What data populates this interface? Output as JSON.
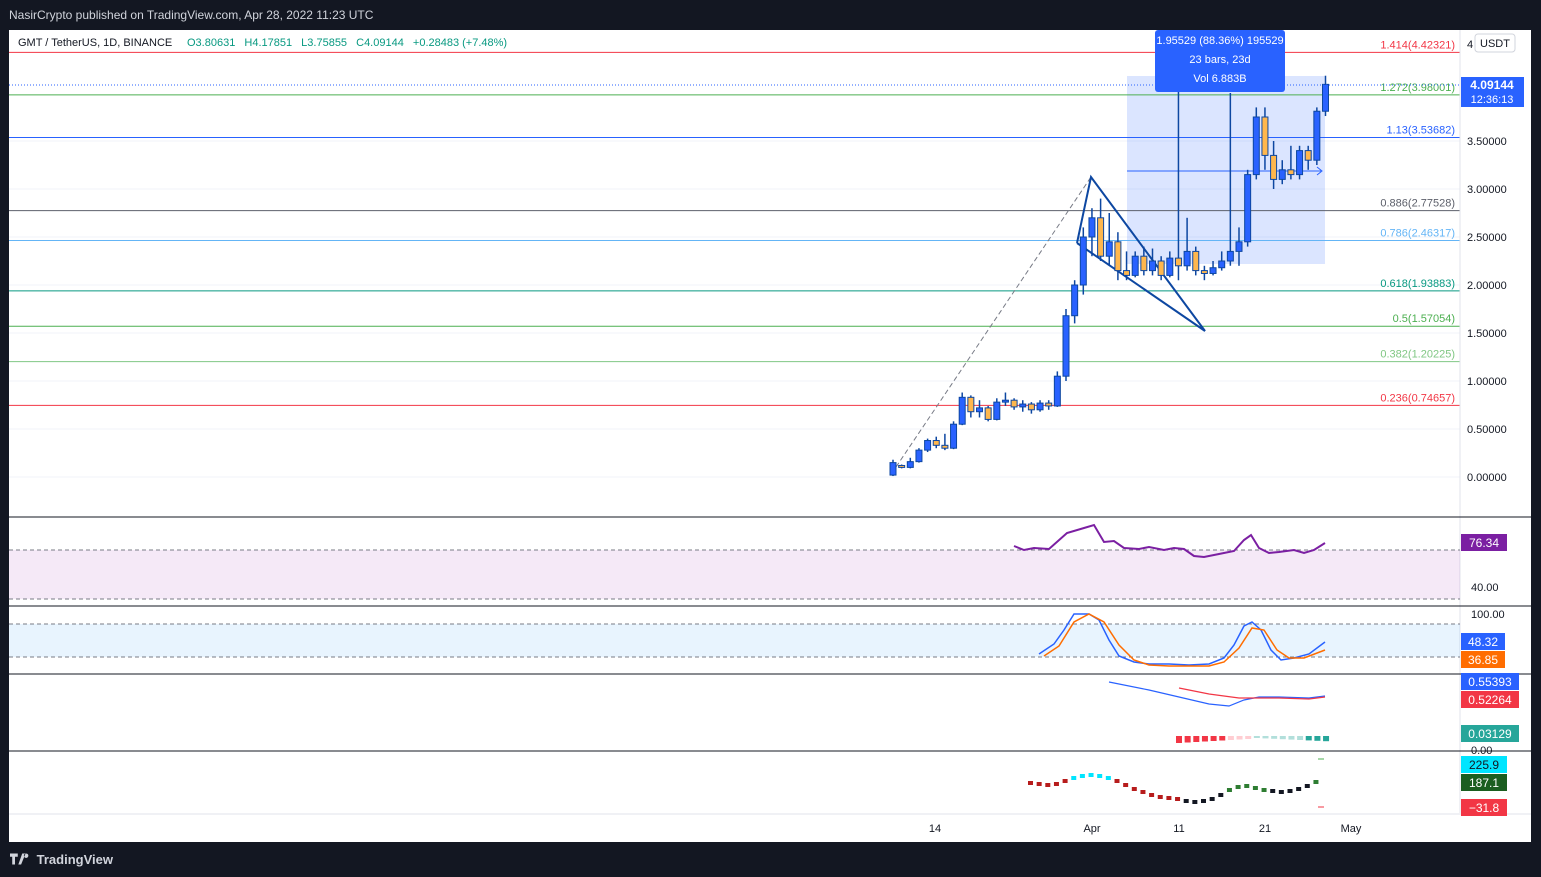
{
  "header": {
    "publisher_line": "NasirCrypto published on TradingView.com, Apr 28, 2022 11:23 UTC"
  },
  "legend": {
    "symbol": "GMT / TetherUS, 1D, BINANCE",
    "open": "O3.80631",
    "high": "H4.17851",
    "low": "L3.75855",
    "close": "C4.09144",
    "change": "+0.28483 (+7.48%)"
  },
  "price_axis": {
    "currency": "USDT",
    "last_price": "4.09144",
    "countdown": "12:36:13",
    "top_tick": "4"
  },
  "measure_box": {
    "line1": "1.95529 (88.36%) 195529",
    "line2": "23 bars, 23d",
    "line3": "Vol 6.883B"
  },
  "fib_levels": [
    {
      "label": "1.414(4.42321)",
      "ratio": 1.414,
      "price": 4.42321,
      "color": "#f23645"
    },
    {
      "label": "1.272(3.98001)",
      "ratio": 1.272,
      "price": 3.98001,
      "color": "#4caf50"
    },
    {
      "label": "1.13(3.53682)",
      "ratio": 1.13,
      "price": 3.53682,
      "color": "#2962ff"
    },
    {
      "label": "0.886(2.77528)",
      "ratio": 0.886,
      "price": 2.77528,
      "color": "#5d606b"
    },
    {
      "label": "0.786(2.46317)",
      "ratio": 0.786,
      "price": 2.46317,
      "color": "#64b5f6"
    },
    {
      "label": "0.618(1.93883)",
      "ratio": 0.618,
      "price": 1.93883,
      "color": "#089981"
    },
    {
      "label": "0.5(1.57054)",
      "ratio": 0.5,
      "price": 1.57054,
      "color": "#4caf50"
    },
    {
      "label": "0.382(1.20225)",
      "ratio": 0.382,
      "price": 1.20225,
      "color": "#81c784"
    },
    {
      "label": "0.236(0.74657)",
      "ratio": 0.236,
      "price": 0.74657,
      "color": "#f23645"
    }
  ],
  "chart_data": {
    "type": "candlestick",
    "symbol": "GMT / TetherUS",
    "interval": "1D",
    "y_ticks": [
      "3.50000",
      "3.00000",
      "2.50000",
      "2.00000",
      "1.50000",
      "1.00000",
      "0.50000",
      "0.00000"
    ],
    "y_tick_values": [
      3.5,
      3.0,
      2.5,
      2.0,
      1.5,
      1.0,
      0.5,
      0.0
    ],
    "x_ticks": [
      "14",
      "Apr",
      "11",
      "21",
      "May"
    ],
    "ylim": [
      -0.05,
      4.6
    ],
    "candles": [
      {
        "date": "2022-03-09",
        "o": 0.02,
        "h": 0.18,
        "l": 0.01,
        "c": 0.15
      },
      {
        "date": "2022-03-10",
        "o": 0.12,
        "h": 0.13,
        "l": 0.09,
        "c": 0.1
      },
      {
        "date": "2022-03-11",
        "o": 0.1,
        "h": 0.2,
        "l": 0.09,
        "c": 0.16
      },
      {
        "date": "2022-03-12",
        "o": 0.16,
        "h": 0.3,
        "l": 0.15,
        "c": 0.28
      },
      {
        "date": "2022-03-13",
        "o": 0.28,
        "h": 0.4,
        "l": 0.26,
        "c": 0.38
      },
      {
        "date": "2022-03-14",
        "o": 0.38,
        "h": 0.42,
        "l": 0.3,
        "c": 0.33
      },
      {
        "date": "2022-03-15",
        "o": 0.33,
        "h": 0.45,
        "l": 0.28,
        "c": 0.3
      },
      {
        "date": "2022-03-16",
        "o": 0.3,
        "h": 0.58,
        "l": 0.29,
        "c": 0.55
      },
      {
        "date": "2022-03-17",
        "o": 0.55,
        "h": 0.88,
        "l": 0.54,
        "c": 0.83
      },
      {
        "date": "2022-03-18",
        "o": 0.83,
        "h": 0.85,
        "l": 0.62,
        "c": 0.68
      },
      {
        "date": "2022-03-19",
        "o": 0.68,
        "h": 0.8,
        "l": 0.62,
        "c": 0.72
      },
      {
        "date": "2022-03-20",
        "o": 0.72,
        "h": 0.74,
        "l": 0.58,
        "c": 0.6
      },
      {
        "date": "2022-03-21",
        "o": 0.6,
        "h": 0.82,
        "l": 0.59,
        "c": 0.78
      },
      {
        "date": "2022-03-22",
        "o": 0.78,
        "h": 0.88,
        "l": 0.74,
        "c": 0.8
      },
      {
        "date": "2022-03-23",
        "o": 0.8,
        "h": 0.82,
        "l": 0.7,
        "c": 0.73
      },
      {
        "date": "2022-03-24",
        "o": 0.73,
        "h": 0.8,
        "l": 0.68,
        "c": 0.76
      },
      {
        "date": "2022-03-25",
        "o": 0.76,
        "h": 0.78,
        "l": 0.66,
        "c": 0.7
      },
      {
        "date": "2022-03-26",
        "o": 0.7,
        "h": 0.8,
        "l": 0.68,
        "c": 0.77
      },
      {
        "date": "2022-03-27",
        "o": 0.77,
        "h": 0.8,
        "l": 0.7,
        "c": 0.74
      },
      {
        "date": "2022-03-28",
        "o": 0.74,
        "h": 1.1,
        "l": 0.73,
        "c": 1.05
      },
      {
        "date": "2022-03-29",
        "o": 1.05,
        "h": 1.75,
        "l": 1.0,
        "c": 1.68
      },
      {
        "date": "2022-03-30",
        "o": 1.68,
        "h": 2.05,
        "l": 1.6,
        "c": 2.0
      },
      {
        "date": "2022-03-31",
        "o": 2.0,
        "h": 2.6,
        "l": 1.9,
        "c": 2.5
      },
      {
        "date": "2022-04-01",
        "o": 2.5,
        "h": 2.8,
        "l": 2.3,
        "c": 2.7
      },
      {
        "date": "2022-04-02",
        "o": 2.7,
        "h": 2.9,
        "l": 2.25,
        "c": 2.3
      },
      {
        "date": "2022-04-03",
        "o": 2.3,
        "h": 2.75,
        "l": 2.2,
        "c": 2.45
      },
      {
        "date": "2022-04-04",
        "o": 2.45,
        "h": 2.55,
        "l": 2.05,
        "c": 2.15
      },
      {
        "date": "2022-04-05",
        "o": 2.15,
        "h": 2.35,
        "l": 2.05,
        "c": 2.1
      },
      {
        "date": "2022-04-06",
        "o": 2.1,
        "h": 2.35,
        "l": 2.08,
        "c": 2.3
      },
      {
        "date": "2022-04-07",
        "o": 2.3,
        "h": 2.4,
        "l": 2.1,
        "c": 2.15
      },
      {
        "date": "2022-04-08",
        "o": 2.15,
        "h": 2.38,
        "l": 2.1,
        "c": 2.25
      },
      {
        "date": "2022-04-09",
        "o": 2.25,
        "h": 2.3,
        "l": 2.05,
        "c": 2.1
      },
      {
        "date": "2022-04-10",
        "o": 2.1,
        "h": 2.35,
        "l": 2.08,
        "c": 2.28
      },
      {
        "date": "2022-04-11",
        "o": 2.28,
        "h": 4.35,
        "l": 2.05,
        "c": 2.2
      },
      {
        "date": "2022-04-12",
        "o": 2.2,
        "h": 2.7,
        "l": 2.15,
        "c": 2.35
      },
      {
        "date": "2022-04-13",
        "o": 2.35,
        "h": 2.4,
        "l": 2.1,
        "c": 2.15
      },
      {
        "date": "2022-04-14",
        "o": 2.15,
        "h": 2.2,
        "l": 2.05,
        "c": 2.12
      },
      {
        "date": "2022-04-15",
        "o": 2.12,
        "h": 2.25,
        "l": 2.1,
        "c": 2.18
      },
      {
        "date": "2022-04-16",
        "o": 2.18,
        "h": 2.35,
        "l": 2.15,
        "c": 2.25
      },
      {
        "date": "2022-04-17",
        "o": 2.25,
        "h": 4.0,
        "l": 2.2,
        "c": 2.35
      },
      {
        "date": "2022-04-18",
        "o": 2.35,
        "h": 2.6,
        "l": 2.2,
        "c": 2.45
      },
      {
        "date": "2022-04-19",
        "o": 2.45,
        "h": 3.2,
        "l": 2.4,
        "c": 3.15
      },
      {
        "date": "2022-04-20",
        "o": 3.15,
        "h": 3.85,
        "l": 3.1,
        "c": 3.75
      },
      {
        "date": "2022-04-21",
        "o": 3.75,
        "h": 3.85,
        "l": 3.2,
        "c": 3.35
      },
      {
        "date": "2022-04-22",
        "o": 3.35,
        "h": 3.5,
        "l": 3.0,
        "c": 3.1
      },
      {
        "date": "2022-04-23",
        "o": 3.1,
        "h": 3.3,
        "l": 3.05,
        "c": 3.2
      },
      {
        "date": "2022-04-24",
        "o": 3.2,
        "h": 3.45,
        "l": 3.1,
        "c": 3.15
      },
      {
        "date": "2022-04-25",
        "o": 3.15,
        "h": 3.45,
        "l": 3.1,
        "c": 3.4
      },
      {
        "date": "2022-04-26",
        "o": 3.4,
        "h": 3.45,
        "l": 3.2,
        "c": 3.3
      },
      {
        "date": "2022-04-27",
        "o": 3.3,
        "h": 3.85,
        "l": 3.25,
        "c": 3.81
      },
      {
        "date": "2022-04-28",
        "o": 3.81,
        "h": 4.18,
        "l": 3.76,
        "c": 4.09
      }
    ],
    "indicators": {
      "rsi": {
        "value": "76.34",
        "level": "40.00",
        "color": "#7b1fa2"
      },
      "stoch": {
        "top": "100.00",
        "k": "48.32",
        "d": "36.85",
        "k_color": "#2962ff",
        "d_color": "#ff6d00"
      },
      "macd": {
        "macd": "0.55393",
        "signal": "0.52264",
        "hist": "0.03129",
        "zero_label": "0.00"
      },
      "osc": {
        "v1": "225.9",
        "v2": "187.1",
        "v3": "−31.8"
      }
    }
  },
  "footer": {
    "brand": "TradingView"
  }
}
